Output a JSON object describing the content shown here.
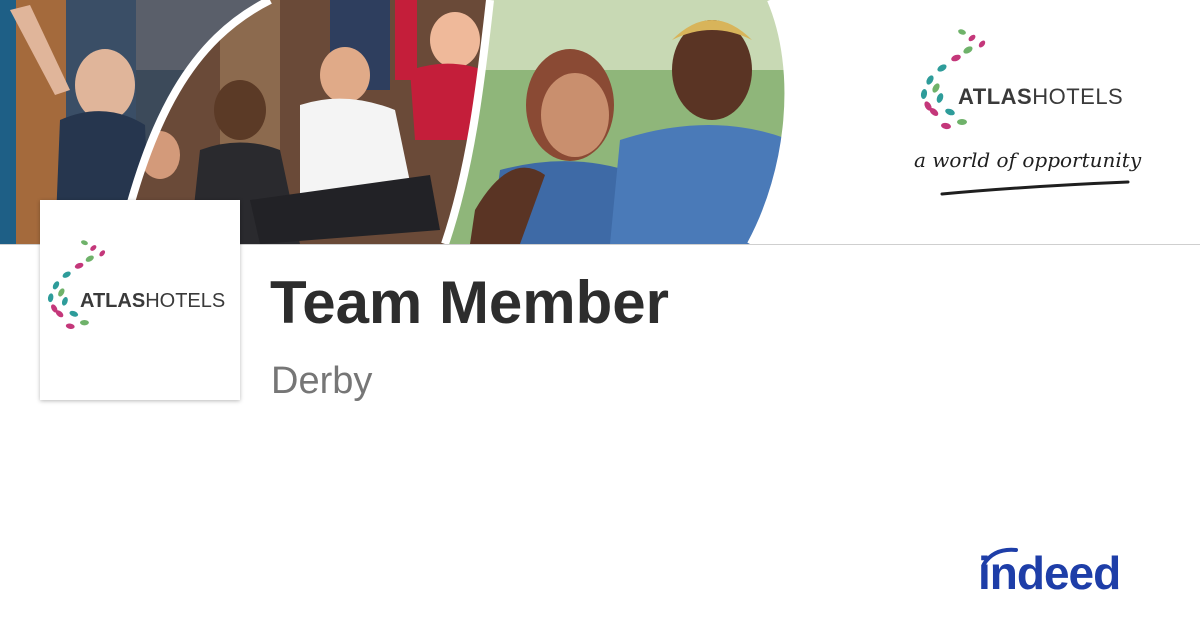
{
  "banner": {
    "brand": {
      "name_bold": "ATLAS",
      "name_regular": "HOTELS",
      "tagline": "a world of opportunity"
    }
  },
  "company_logo": {
    "name_bold": "ATLAS",
    "name_regular": "HOTELS"
  },
  "job": {
    "title": "Team Member",
    "location": "Derby"
  },
  "footer": {
    "indeed_logo_text": "indeed"
  },
  "colors": {
    "brand_teal": "#2e9c9a",
    "brand_magenta": "#c4377a",
    "brand_green": "#6fb26a",
    "indeed_blue": "#1e3ea8",
    "title_text": "#2d2d2d",
    "location_text": "#767676"
  }
}
